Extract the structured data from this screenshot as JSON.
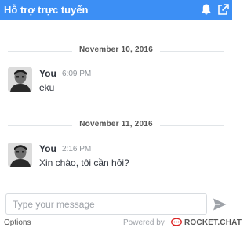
{
  "header": {
    "title": "Hỗ trợ trực tuyến",
    "color": "#3c8ff5"
  },
  "icons": {
    "bell": "bell-icon",
    "popout": "popout-icon",
    "send": "send-icon",
    "brand": "rocket-chat-logo-icon"
  },
  "messages": [
    {
      "date": "November 10, 2016",
      "author": "You",
      "time": "6:09 PM",
      "text": "eku"
    },
    {
      "date": "November 11, 2016",
      "author": "You",
      "time": "2:16 PM",
      "text": "Xin chào, tôi cần hỏi?"
    }
  ],
  "composer": {
    "placeholder": "Type your message",
    "value": ""
  },
  "footer": {
    "options_label": "Options",
    "powered_label": "Powered by",
    "brand_name": "ROCKET.CHAT",
    "brand_color": "#db2323"
  }
}
